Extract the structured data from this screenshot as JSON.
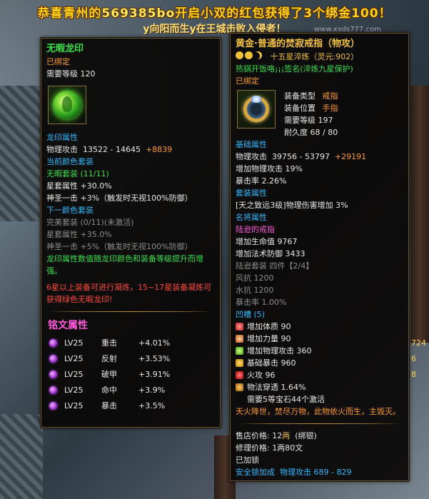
{
  "announcement": {
    "line1_a": "恭喜青州的",
    "line1_b": "569385bo",
    "line1_c": "开启小双的红包获得了3个绑金100！",
    "line2": "y向阳而生y在王城击败入侵者！",
    "watermark": "www.xxds777.com"
  },
  "side_numbers": [
    "724",
    "6",
    "8"
  ],
  "panel_left": {
    "name": "无暇龙印",
    "bound": "已绑定",
    "required_level": "需要等级 120",
    "icon": "dragon-seal-orb-icon",
    "attr_title": "龙印属性",
    "phys_attack_label": "物理攻击",
    "phys_attack_value": "13522 - 14645",
    "phys_attack_bonus": "+8839",
    "current_color_set": "当前颜色套装",
    "set_name": "无暇套装 (11/11)",
    "star_attr": "星套属性 +30.0%",
    "divine_strike": "神圣一击 +3%（触发时无视100%防御）",
    "next_color_set": "下一颜色套装",
    "next_set_name": "完美套装 (0/11)(未激活)",
    "next_star_attr": "星套属性 +35.0%",
    "next_divine_strike": "神圣一击 +5%（触发时无视100%防御）",
    "note_green": "龙印属性数值随龙印颜色和装备等级提升而增强。",
    "note_red": "6星以上装备可进行凝炼，15~17星装备凝炼可获得绿色无暇龙印!",
    "rune_title": "铭文属性",
    "runes": [
      {
        "icon": "rune-gem-icon",
        "level": "LV25",
        "name": "重击",
        "value": "+4.01%"
      },
      {
        "icon": "rune-gem-icon",
        "level": "LV25",
        "name": "反射",
        "value": "+3.53%"
      },
      {
        "icon": "rune-gem-icon",
        "level": "LV25",
        "name": "破甲",
        "value": "+3.91%"
      },
      {
        "icon": "rune-gem-icon",
        "level": "LV25",
        "name": "命中",
        "value": "+3.9%"
      },
      {
        "icon": "rune-gem-icon",
        "level": "LV25",
        "name": "暴击",
        "value": "+3.5%"
      }
    ]
  },
  "panel_right": {
    "name": "黄金·普通的焚寂戒指（物攻）",
    "refine": "十五星淬炼（灵元:902）",
    "note_green": "热锅开饭咯¡¡¡签名(淬炼九星保护)",
    "bound": "已绑定",
    "icon": "gold-ring-icon",
    "equip_type_label": "装备类型",
    "equip_type_value": "戒指",
    "equip_slot_label": "装备位置",
    "equip_slot_value": "手指",
    "required_level": "需要等级 197",
    "durability": "耐久度 68 / 80",
    "base_title": "基础属性",
    "phys_attack_label": "物理攻击",
    "phys_attack_value": "39756 - 53797",
    "phys_attack_bonus": "+29191",
    "phys_attack_pct": "增加物理攻击 19%",
    "crit_rate": "暴击率  2.26%",
    "set_title": "套装属性",
    "set_line": "[天之致远3级]物理伤害增加 3%",
    "famous_title": "名将属性",
    "famous_name": "陆逊的戒指",
    "hp": "增加生命值 9767",
    "magic_def": "增加法术防御 3433",
    "luxun_set": "陆逊套装 四件【2/4】",
    "wind_res": "风抗 1200",
    "water_res": "水抗 1200",
    "crit_rate2": "暴击率 1.00%",
    "socket_title": "凹槽 (5)",
    "sockets": [
      {
        "icon": "red-gem-icon",
        "text": "增加体质 90"
      },
      {
        "icon": "orange-gem-icon",
        "text": "增加力量 90"
      },
      {
        "icon": "green-gem-icon",
        "text": "增加物理攻击 360"
      },
      {
        "icon": "yellow-gem-icon",
        "text": "基础暴击 960"
      },
      {
        "icon": "red-gem-icon",
        "text": "火攻 96"
      },
      {
        "icon": "amber-gem-icon",
        "text": "物法穿透  1.64%"
      }
    ],
    "socket_activate": "需要5等宝石44个激活",
    "flavor": "天火降世，焚尽万物，此物依火而生，主毁灭。",
    "sell_label": "售店价格: 12",
    "sell_unit": "两",
    "sell_bound": "(绑银)",
    "repair": "修理价格: 1两80文",
    "locked": "已加锁",
    "security_label": "安全锁加成",
    "security_value": "物理攻击 689 - 829"
  }
}
